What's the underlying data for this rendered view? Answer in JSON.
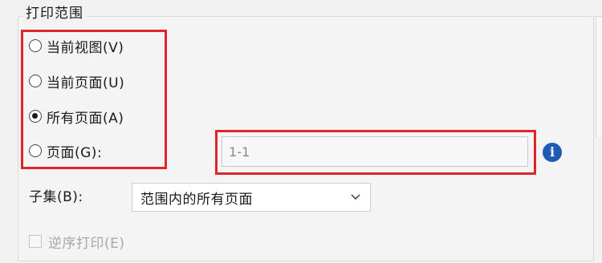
{
  "print_range": {
    "title": "打印范围",
    "options": [
      {
        "label": "当前视图(V)",
        "checked": false
      },
      {
        "label": "当前页面(U)",
        "checked": false
      },
      {
        "label": "所有页面(A)",
        "checked": true
      },
      {
        "label": "页面(G):",
        "checked": false
      }
    ],
    "pages_input": {
      "value": "1-1",
      "placeholder": ""
    },
    "info_icon": "info-icon"
  },
  "subset": {
    "label": "子集(B):",
    "selected": "范围内的所有页面"
  },
  "reverse_print": {
    "label": "逆序打印(E)",
    "checked": false,
    "enabled": false
  },
  "colors": {
    "highlight_red": "#e0252a",
    "info_blue": "#1f5bb5",
    "disabled_text": "#a8a8a8"
  }
}
